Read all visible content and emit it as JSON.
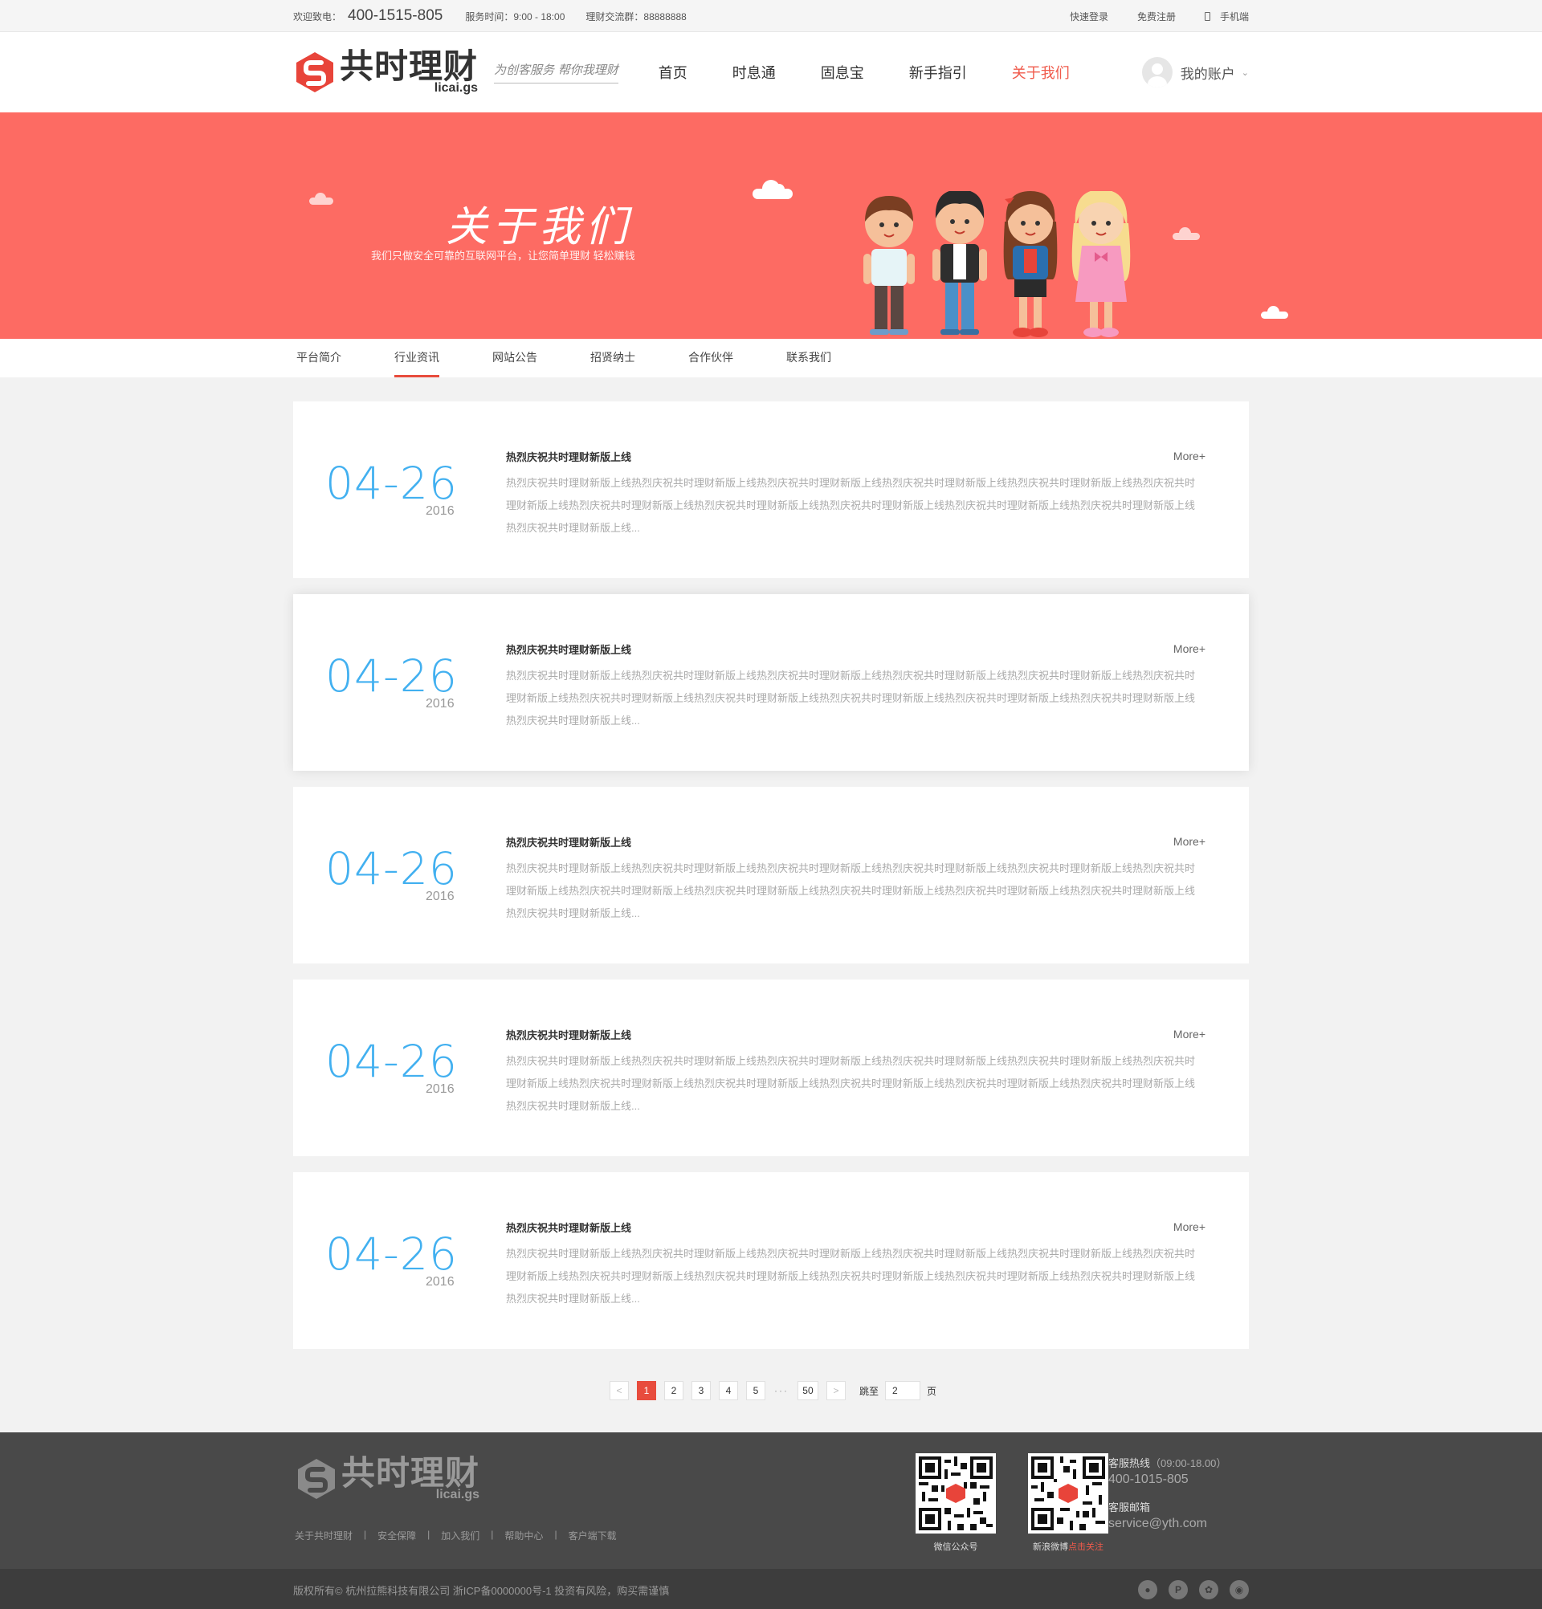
{
  "topbar": {
    "welcome": "欢迎致电：",
    "phone": "400-1515-805",
    "hours": "服务时间：9:00 - 18:00",
    "group": "理财交流群：88888888",
    "login": "快速登录",
    "register": "免费注册",
    "mobile": "手机端"
  },
  "header": {
    "logo_cn": "共时理财",
    "logo_en": "licai.gs",
    "slogan": "为创客服务 帮你我理财",
    "nav": [
      "首页",
      "时息通",
      "固息宝",
      "新手指引",
      "关于我们"
    ],
    "active_nav": "关于我们",
    "account": "我的账户"
  },
  "banner": {
    "title": "关于我们",
    "subtitle": "我们只做安全可靠的互联网平台，让您简单理财 轻松赚钱"
  },
  "subnav": {
    "items": [
      "平台简介",
      "行业资讯",
      "网站公告",
      "招贤纳士",
      "合作伙伴",
      "联系我们"
    ],
    "active": "行业资讯"
  },
  "articles": [
    {
      "date": "04-26",
      "year": "2016",
      "title": "热烈庆祝共时理财新版上线",
      "more": "More+",
      "body": "热烈庆祝共时理财新版上线热烈庆祝共时理财新版上线热烈庆祝共时理财新版上线热烈庆祝共时理财新版上线热烈庆祝共时理财新版上线热烈庆祝共时理财新版上线热烈庆祝共时理财新版上线热烈庆祝共时理财新版上线热烈庆祝共时理财新版上线热烈庆祝共时理财新版上线热烈庆祝共时理财新版上线热烈庆祝共时理财新版上线..."
    },
    {
      "date": "04-26",
      "year": "2016",
      "title": "热烈庆祝共时理财新版上线",
      "more": "More+",
      "body": "热烈庆祝共时理财新版上线热烈庆祝共时理财新版上线热烈庆祝共时理财新版上线热烈庆祝共时理财新版上线热烈庆祝共时理财新版上线热烈庆祝共时理财新版上线热烈庆祝共时理财新版上线热烈庆祝共时理财新版上线热烈庆祝共时理财新版上线热烈庆祝共时理财新版上线热烈庆祝共时理财新版上线热烈庆祝共时理财新版上线..."
    },
    {
      "date": "04-26",
      "year": "2016",
      "title": "热烈庆祝共时理财新版上线",
      "more": "More+",
      "body": "热烈庆祝共时理财新版上线热烈庆祝共时理财新版上线热烈庆祝共时理财新版上线热烈庆祝共时理财新版上线热烈庆祝共时理财新版上线热烈庆祝共时理财新版上线热烈庆祝共时理财新版上线热烈庆祝共时理财新版上线热烈庆祝共时理财新版上线热烈庆祝共时理财新版上线热烈庆祝共时理财新版上线热烈庆祝共时理财新版上线..."
    },
    {
      "date": "04-26",
      "year": "2016",
      "title": "热烈庆祝共时理财新版上线",
      "more": "More+",
      "body": "热烈庆祝共时理财新版上线热烈庆祝共时理财新版上线热烈庆祝共时理财新版上线热烈庆祝共时理财新版上线热烈庆祝共时理财新版上线热烈庆祝共时理财新版上线热烈庆祝共时理财新版上线热烈庆祝共时理财新版上线热烈庆祝共时理财新版上线热烈庆祝共时理财新版上线热烈庆祝共时理财新版上线热烈庆祝共时理财新版上线..."
    },
    {
      "date": "04-26",
      "year": "2016",
      "title": "热烈庆祝共时理财新版上线",
      "more": "More+",
      "body": "热烈庆祝共时理财新版上线热烈庆祝共时理财新版上线热烈庆祝共时理财新版上线热烈庆祝共时理财新版上线热烈庆祝共时理财新版上线热烈庆祝共时理财新版上线热烈庆祝共时理财新版上线热烈庆祝共时理财新版上线热烈庆祝共时理财新版上线热烈庆祝共时理财新版上线热烈庆祝共时理财新版上线热烈庆祝共时理财新版上线..."
    }
  ],
  "pager": {
    "prev": "<",
    "pages": [
      "1",
      "2",
      "3",
      "4",
      "5"
    ],
    "current": "1",
    "ellipsis": "···",
    "last": "50",
    "next": ">",
    "jump_label": "跳至",
    "jump_value": "2",
    "page_unit": "页"
  },
  "footer": {
    "logo_cn": "共时理财",
    "logo_en": "licai.gs",
    "links": [
      "关于共时理财",
      "安全保障",
      "加入我们",
      "帮助中心",
      "客户端下载"
    ],
    "link_sep": "|",
    "qr_wechat": "微信公众号",
    "qr_weibo": "新浪微博",
    "qr_weibo_action": "点击关注",
    "hotline_label": "客服热线",
    "hotline_hours": "（09:00-18.00）",
    "hotline": "400-1015-805",
    "email_label": "客服邮箱",
    "email": "service@yth.com",
    "copyright": "版权所有© 杭州拉熊科技有限公司 浙ICP备0000000号-1 投资有风险，购买需谨慎",
    "social_icons": [
      "qq-icon",
      "pinterest-icon",
      "wechat-icon",
      "weibo-icon"
    ]
  },
  "colors": {
    "accent": "#f05a4b",
    "banner": "#fd6b63",
    "date_blue": "#42b0f0",
    "footer": "#494949"
  }
}
